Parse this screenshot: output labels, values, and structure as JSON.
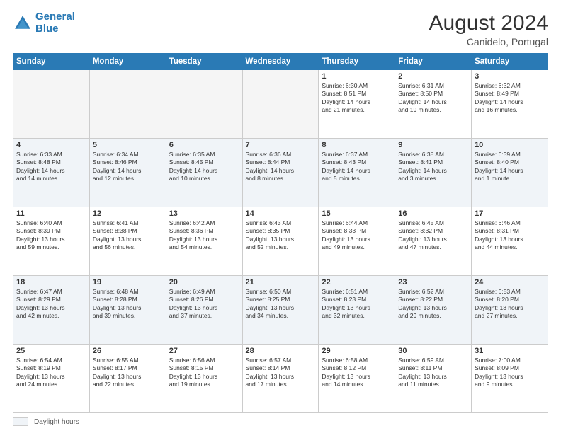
{
  "header": {
    "logo_line1": "General",
    "logo_line2": "Blue",
    "month_title": "August 2024",
    "subtitle": "Canidelo, Portugal"
  },
  "weekdays": [
    "Sunday",
    "Monday",
    "Tuesday",
    "Wednesday",
    "Thursday",
    "Friday",
    "Saturday"
  ],
  "weeks": [
    [
      {
        "num": "",
        "info": ""
      },
      {
        "num": "",
        "info": ""
      },
      {
        "num": "",
        "info": ""
      },
      {
        "num": "",
        "info": ""
      },
      {
        "num": "1",
        "info": "Sunrise: 6:30 AM\nSunset: 8:51 PM\nDaylight: 14 hours\nand 21 minutes."
      },
      {
        "num": "2",
        "info": "Sunrise: 6:31 AM\nSunset: 8:50 PM\nDaylight: 14 hours\nand 19 minutes."
      },
      {
        "num": "3",
        "info": "Sunrise: 6:32 AM\nSunset: 8:49 PM\nDaylight: 14 hours\nand 16 minutes."
      }
    ],
    [
      {
        "num": "4",
        "info": "Sunrise: 6:33 AM\nSunset: 8:48 PM\nDaylight: 14 hours\nand 14 minutes."
      },
      {
        "num": "5",
        "info": "Sunrise: 6:34 AM\nSunset: 8:46 PM\nDaylight: 14 hours\nand 12 minutes."
      },
      {
        "num": "6",
        "info": "Sunrise: 6:35 AM\nSunset: 8:45 PM\nDaylight: 14 hours\nand 10 minutes."
      },
      {
        "num": "7",
        "info": "Sunrise: 6:36 AM\nSunset: 8:44 PM\nDaylight: 14 hours\nand 8 minutes."
      },
      {
        "num": "8",
        "info": "Sunrise: 6:37 AM\nSunset: 8:43 PM\nDaylight: 14 hours\nand 5 minutes."
      },
      {
        "num": "9",
        "info": "Sunrise: 6:38 AM\nSunset: 8:41 PM\nDaylight: 14 hours\nand 3 minutes."
      },
      {
        "num": "10",
        "info": "Sunrise: 6:39 AM\nSunset: 8:40 PM\nDaylight: 14 hours\nand 1 minute."
      }
    ],
    [
      {
        "num": "11",
        "info": "Sunrise: 6:40 AM\nSunset: 8:39 PM\nDaylight: 13 hours\nand 59 minutes."
      },
      {
        "num": "12",
        "info": "Sunrise: 6:41 AM\nSunset: 8:38 PM\nDaylight: 13 hours\nand 56 minutes."
      },
      {
        "num": "13",
        "info": "Sunrise: 6:42 AM\nSunset: 8:36 PM\nDaylight: 13 hours\nand 54 minutes."
      },
      {
        "num": "14",
        "info": "Sunrise: 6:43 AM\nSunset: 8:35 PM\nDaylight: 13 hours\nand 52 minutes."
      },
      {
        "num": "15",
        "info": "Sunrise: 6:44 AM\nSunset: 8:33 PM\nDaylight: 13 hours\nand 49 minutes."
      },
      {
        "num": "16",
        "info": "Sunrise: 6:45 AM\nSunset: 8:32 PM\nDaylight: 13 hours\nand 47 minutes."
      },
      {
        "num": "17",
        "info": "Sunrise: 6:46 AM\nSunset: 8:31 PM\nDaylight: 13 hours\nand 44 minutes."
      }
    ],
    [
      {
        "num": "18",
        "info": "Sunrise: 6:47 AM\nSunset: 8:29 PM\nDaylight: 13 hours\nand 42 minutes."
      },
      {
        "num": "19",
        "info": "Sunrise: 6:48 AM\nSunset: 8:28 PM\nDaylight: 13 hours\nand 39 minutes."
      },
      {
        "num": "20",
        "info": "Sunrise: 6:49 AM\nSunset: 8:26 PM\nDaylight: 13 hours\nand 37 minutes."
      },
      {
        "num": "21",
        "info": "Sunrise: 6:50 AM\nSunset: 8:25 PM\nDaylight: 13 hours\nand 34 minutes."
      },
      {
        "num": "22",
        "info": "Sunrise: 6:51 AM\nSunset: 8:23 PM\nDaylight: 13 hours\nand 32 minutes."
      },
      {
        "num": "23",
        "info": "Sunrise: 6:52 AM\nSunset: 8:22 PM\nDaylight: 13 hours\nand 29 minutes."
      },
      {
        "num": "24",
        "info": "Sunrise: 6:53 AM\nSunset: 8:20 PM\nDaylight: 13 hours\nand 27 minutes."
      }
    ],
    [
      {
        "num": "25",
        "info": "Sunrise: 6:54 AM\nSunset: 8:19 PM\nDaylight: 13 hours\nand 24 minutes."
      },
      {
        "num": "26",
        "info": "Sunrise: 6:55 AM\nSunset: 8:17 PM\nDaylight: 13 hours\nand 22 minutes."
      },
      {
        "num": "27",
        "info": "Sunrise: 6:56 AM\nSunset: 8:15 PM\nDaylight: 13 hours\nand 19 minutes."
      },
      {
        "num": "28",
        "info": "Sunrise: 6:57 AM\nSunset: 8:14 PM\nDaylight: 13 hours\nand 17 minutes."
      },
      {
        "num": "29",
        "info": "Sunrise: 6:58 AM\nSunset: 8:12 PM\nDaylight: 13 hours\nand 14 minutes."
      },
      {
        "num": "30",
        "info": "Sunrise: 6:59 AM\nSunset: 8:11 PM\nDaylight: 13 hours\nand 11 minutes."
      },
      {
        "num": "31",
        "info": "Sunrise: 7:00 AM\nSunset: 8:09 PM\nDaylight: 13 hours\nand 9 minutes."
      }
    ]
  ],
  "footer": {
    "legend_label": "Daylight hours"
  }
}
